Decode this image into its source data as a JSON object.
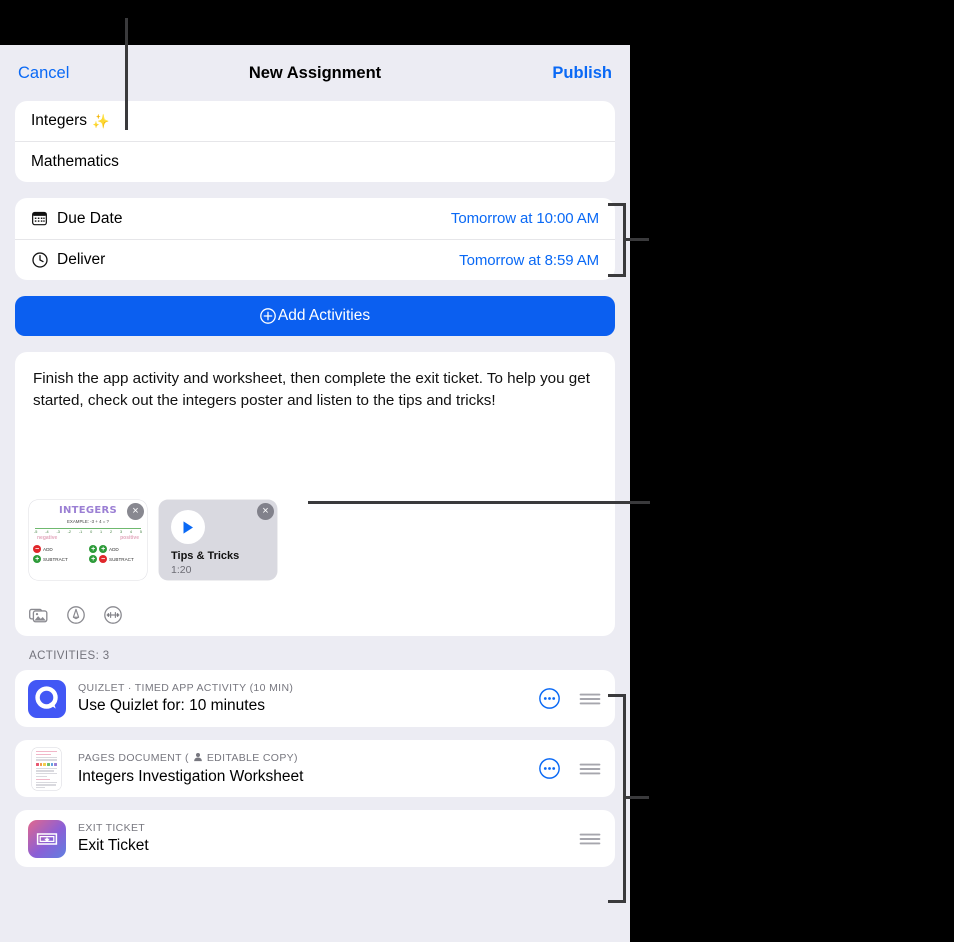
{
  "navbar": {
    "cancel_label": "Cancel",
    "title": "New Assignment",
    "publish_label": "Publish"
  },
  "details": {
    "title_value": "Integers",
    "title_sparkle": "✨",
    "subject_value": "Mathematics"
  },
  "schedule": {
    "due_date_label": "Due Date",
    "due_date_value": "Tomorrow at 10:00 AM",
    "deliver_label": "Deliver",
    "deliver_value": "Tomorrow at 8:59 AM"
  },
  "add_activities": {
    "label": "Add Activities",
    "icon": "plus-circle-icon"
  },
  "instructions": {
    "text": "Finish the app activity and worksheet, then complete the exit ticket. To help you get started, check out the integers poster and listen to the tips and tricks!",
    "attachments": [
      {
        "kind": "image",
        "name": "integers-poster",
        "poster_title": "INTEGERS",
        "poster_example": "EXAMPLE:  -3 + 4 = ?",
        "poster_number_line": [
          "-5",
          "-4",
          "-3",
          "-2",
          "-1",
          "0",
          "1",
          "2",
          "3",
          "4",
          "5"
        ],
        "poster_left_word": "negative",
        "poster_right_word": "positive",
        "poster_rows": [
          {
            "left_sign": "−",
            "left_text": "ADD",
            "right_sign_a": "+",
            "right_sign_b": "+",
            "right_text": "ADD"
          },
          {
            "left_sign": "+",
            "left_text": "SUBTRACT",
            "right_sign_a": "+",
            "right_sign_b": "−",
            "right_text": "SUBTRACT"
          }
        ],
        "remove_label": "×"
      },
      {
        "kind": "video",
        "name": "tips-and-tricks-video",
        "title": "Tips & Tricks",
        "duration": "1:20",
        "play_icon": "play-icon",
        "remove_label": "×"
      }
    ],
    "media_tools": [
      {
        "icon": "photo-library-icon",
        "name": "insert-photo"
      },
      {
        "icon": "markup-pen-icon",
        "name": "insert-markup"
      },
      {
        "icon": "audio-wave-icon",
        "name": "insert-audio"
      }
    ]
  },
  "activities": {
    "section_label": "ACTIVITIES: 3",
    "items": [
      {
        "icon": "quizlet-app-icon",
        "kicker": "QUIZLET · TIMED APP ACTIVITY (10 MIN)",
        "title": "Use Quizlet for: 10 minutes",
        "has_more": true,
        "has_drag": true,
        "editable_badge": ""
      },
      {
        "icon": "pages-document-icon",
        "kicker": "PAGES DOCUMENT  (",
        "kicker_badge": "EDITABLE COPY)",
        "title": "Integers Investigation Worksheet",
        "has_more": true,
        "has_drag": true
      },
      {
        "icon": "exit-ticket-icon",
        "kicker": "EXIT TICKET",
        "title": "Exit Ticket",
        "has_more": false,
        "has_drag": true
      }
    ]
  },
  "colors": {
    "accent_blue": "#0a69f5",
    "button_blue": "#0b5ff0",
    "background": "#ececf3",
    "card": "#ffffff",
    "secondary_text": "#73737c",
    "callout": "#3a3a3c"
  },
  "annotations": {
    "pointer_title_field": "vertical-line-to-title",
    "pointer_schedule": "bracket-to-schedule-card",
    "pointer_attachments": "line-to-attachments",
    "pointer_activities": "bracket-to-activities-list"
  }
}
